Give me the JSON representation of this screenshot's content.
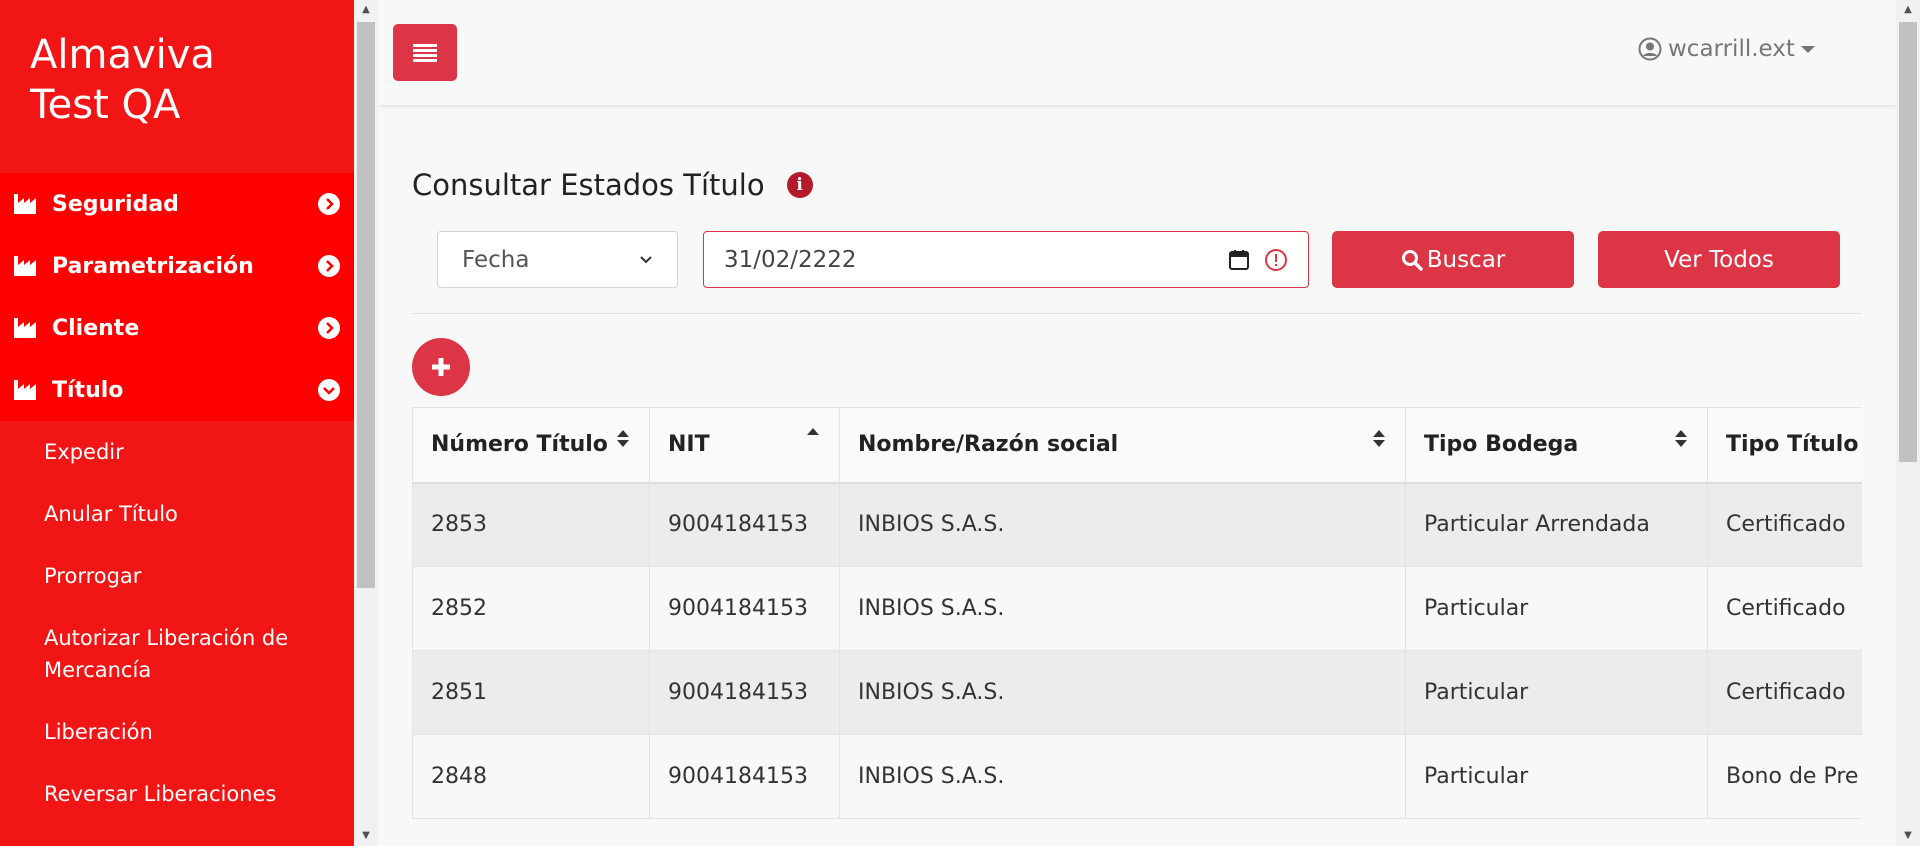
{
  "app": {
    "brand_line1": "Almaviva",
    "brand_line2": "Test QA"
  },
  "sidebar": {
    "menu": [
      {
        "label": "Seguridad",
        "expanded": false
      },
      {
        "label": "Parametrización",
        "expanded": false
      },
      {
        "label": "Cliente",
        "expanded": false
      },
      {
        "label": "Título",
        "expanded": true
      }
    ],
    "submenu": [
      "Expedir",
      "Anular Título",
      "Prorrogar",
      "Autorizar Liberación de Mercancía",
      "Liberación",
      "Reversar Liberaciones"
    ]
  },
  "header": {
    "user": "wcarrill.ext"
  },
  "page": {
    "title": "Consultar Estados Título",
    "filter_select": "Fecha",
    "date_value": "31/02/2222",
    "search_label": "Buscar",
    "view_all_label": "Ver Todos"
  },
  "table": {
    "headers": [
      "Número Título",
      "NIT",
      "Nombre/Razón social",
      "Tipo Bodega",
      "Tipo Título"
    ],
    "rows": [
      [
        "2853",
        "9004184153",
        "INBIOS S.A.S.",
        "Particular Arrendada",
        "Certificado"
      ],
      [
        "2852",
        "9004184153",
        "INBIOS S.A.S.",
        "Particular",
        "Certificado"
      ],
      [
        "2851",
        "9004184153",
        "INBIOS S.A.S.",
        "Particular",
        "Certificado"
      ],
      [
        "2848",
        "9004184153",
        "INBIOS S.A.S.",
        "Particular",
        "Bono de Pre"
      ]
    ]
  },
  "colors": {
    "sidebar": "#f21515",
    "menu": "#ff0000",
    "accent": "#dc3545"
  }
}
